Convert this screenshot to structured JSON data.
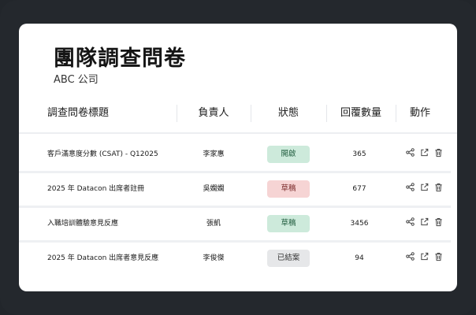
{
  "page": {
    "title": "團隊調查問卷",
    "org": "ABC 公司"
  },
  "table": {
    "headers": [
      "調查問卷標題",
      "負責人",
      "狀態",
      "回覆數量",
      "動作"
    ],
    "rows": [
      {
        "title": "客戶滿意度分數 (CSAT) - Q12025",
        "owner": "李家惠",
        "status": "開啟",
        "status_kind": "open",
        "responses": "365"
      },
      {
        "title": "2025 年 Datacon 出席者註冊",
        "owner": "吳嫻嫻",
        "status": "草稿",
        "status_kind": "draft",
        "responses": "677"
      },
      {
        "title": "入職培訓體驗意見反應",
        "owner": "張凱",
        "status": "草稿",
        "status_kind": "draft2",
        "responses": "3456"
      },
      {
        "title": "2025 年 Datacon 出席者意見反應",
        "owner": "李俊傑",
        "status": "已結案",
        "status_kind": "closed",
        "responses": "94"
      }
    ],
    "action_icons": [
      "share-icon",
      "export-icon",
      "trash-icon"
    ]
  },
  "colors": {
    "open_bg": "#cdeadb",
    "open_fg": "#1e5b3c",
    "draft_bg": "#f6d4d4",
    "draft_fg": "#7a2a2a",
    "draft2_bg": "#cdeadb",
    "draft2_fg": "#1e5b3c",
    "closed_bg": "#e6e7e9",
    "closed_fg": "#333333",
    "frame": "#24282d"
  }
}
